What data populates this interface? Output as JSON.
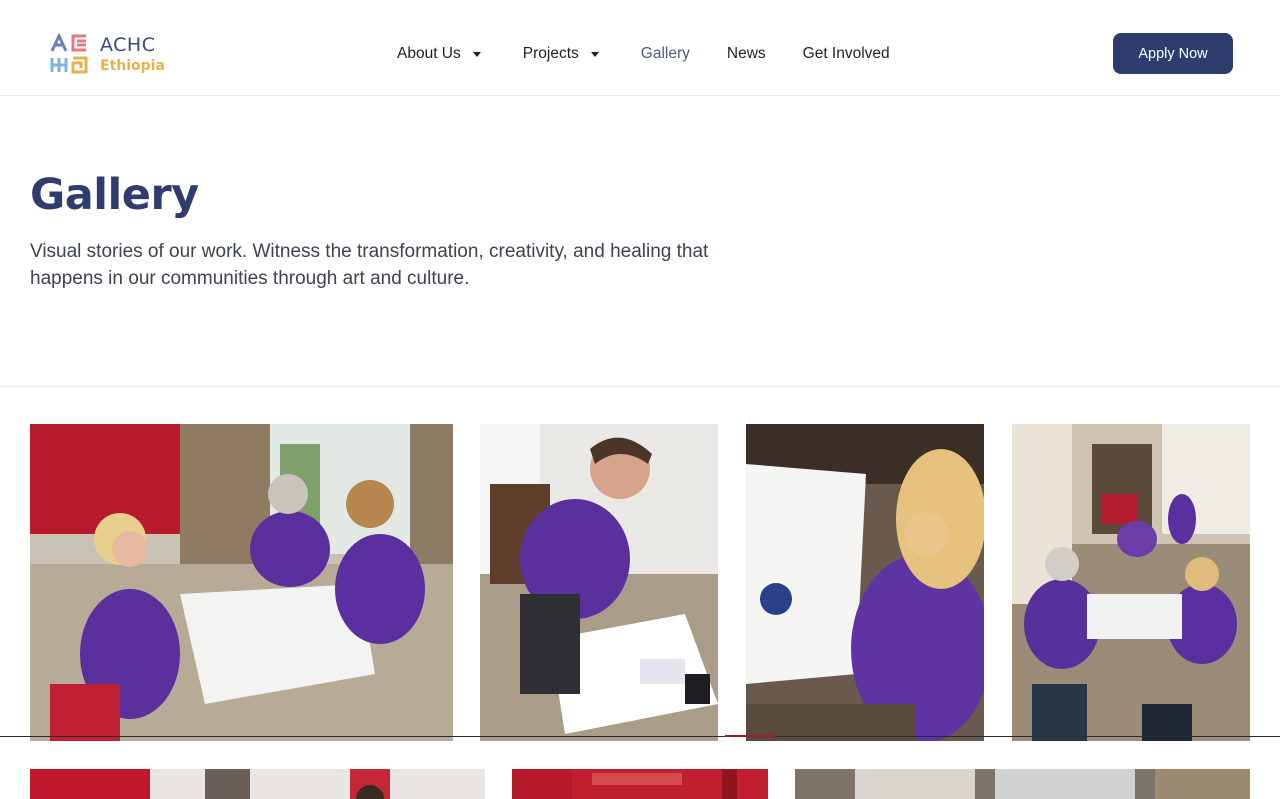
{
  "brand": {
    "title": "ACHC",
    "subtitle": "Ethiopia"
  },
  "nav": {
    "items": [
      {
        "label": "About Us",
        "has_dropdown": true,
        "active": false
      },
      {
        "label": "Projects",
        "has_dropdown": true,
        "active": false
      },
      {
        "label": "Gallery",
        "has_dropdown": false,
        "active": true
      },
      {
        "label": "News",
        "has_dropdown": false,
        "active": false
      },
      {
        "label": "Get Involved",
        "has_dropdown": false,
        "active": false
      }
    ],
    "cta": "Apply Now"
  },
  "hero": {
    "title": "Gallery",
    "intro": "Visual stories of our work. Witness the transformation, creativity, and healing that happens in our communities through art and culture."
  },
  "gallery": {
    "photos": [
      {
        "subject": "three women in purple t-shirts painting stones at a white table"
      },
      {
        "subject": "smiling man in purple t-shirt painting at a table"
      },
      {
        "subject": "woman with blonde ponytail painting a stone"
      },
      {
        "subject": "group of volunteers painting in a large hall"
      },
      {
        "subject": "photo partially visible"
      },
      {
        "subject": "photo partially visible"
      },
      {
        "subject": "photo partially visible"
      }
    ]
  },
  "colors": {
    "brand_navy": "#2e3d6e",
    "brand_gold": "#e7b24a",
    "shirt_purple": "#5a2f9e"
  }
}
